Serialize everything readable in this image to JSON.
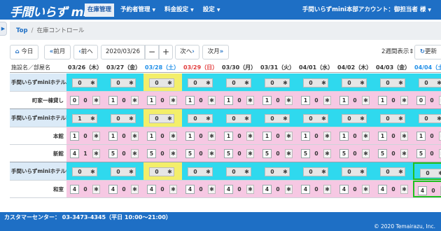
{
  "app": {
    "logo": "手間いらず mini"
  },
  "nav": {
    "items": [
      {
        "label": "在庫管理",
        "active": true,
        "dropdown": false
      },
      {
        "label": "予約者管理",
        "active": false,
        "dropdown": true
      },
      {
        "label": "料金設定",
        "active": false,
        "dropdown": true
      },
      {
        "label": "設定",
        "active": false,
        "dropdown": true
      }
    ],
    "account": "手間いらずmini本部アカウント：御担当者 様"
  },
  "breadcrumb": {
    "top": "Top",
    "separator": "/",
    "current": "在庫コントロール"
  },
  "toolbar": {
    "today": "今日",
    "prev_month": "前月",
    "prev": "前へ",
    "date": "2020/03/26",
    "minus": "−",
    "plus": "+",
    "next": "次へ",
    "next_month": "次月",
    "period": "2週間表示",
    "refresh": "更新"
  },
  "grid": {
    "name_header": "施設名／部屋名",
    "dates": [
      {
        "label": "03/26（木）",
        "day": "weekday"
      },
      {
        "label": "03/27（金）",
        "day": "weekday"
      },
      {
        "label": "03/28（土）",
        "day": "sat"
      },
      {
        "label": "03/29（日）",
        "day": "sun"
      },
      {
        "label": "03/30（月）",
        "day": "weekday"
      },
      {
        "label": "03/31（火）",
        "day": "weekday"
      },
      {
        "label": "04/01（水）",
        "day": "weekday"
      },
      {
        "label": "04/02（木）",
        "day": "weekday"
      },
      {
        "label": "04/03（金）",
        "day": "weekday"
      },
      {
        "label": "04/04（土）",
        "day": "sat"
      }
    ],
    "rows": [
      {
        "type": "hotel",
        "label": "手間いらずminiホテルA",
        "cells": [
          [
            0
          ],
          [
            0
          ],
          [
            0
          ],
          [
            0
          ],
          [
            0
          ],
          [
            0
          ],
          [
            0
          ],
          [
            0
          ],
          [
            0
          ],
          [
            0
          ]
        ]
      },
      {
        "type": "room",
        "label": "町家一棟貸し",
        "cells": [
          [
            0,
            0
          ],
          [
            1,
            0
          ],
          [
            1,
            0
          ],
          [
            1,
            0
          ],
          [
            1,
            0
          ],
          [
            1,
            0
          ],
          [
            1,
            0
          ],
          [
            1,
            0
          ],
          [
            1,
            0
          ],
          [
            0,
            0
          ]
        ]
      },
      {
        "type": "hotel",
        "label": "手間いらずminiホテルB",
        "cells": [
          [
            1
          ],
          [
            0
          ],
          [
            0
          ],
          [
            0
          ],
          [
            0
          ],
          [
            0
          ],
          [
            0
          ],
          [
            0
          ],
          [
            0
          ],
          [
            0
          ]
        ]
      },
      {
        "type": "room",
        "label": "本館",
        "cells": [
          [
            1,
            0
          ],
          [
            1,
            0
          ],
          [
            1,
            0
          ],
          [
            1,
            0
          ],
          [
            1,
            0
          ],
          [
            1,
            0
          ],
          [
            1,
            0
          ],
          [
            1,
            0
          ],
          [
            1,
            0
          ],
          [
            1,
            0
          ]
        ]
      },
      {
        "type": "room",
        "label": "新館",
        "cells": [
          [
            4,
            1
          ],
          [
            5,
            0
          ],
          [
            5,
            0
          ],
          [
            5,
            0
          ],
          [
            5,
            0
          ],
          [
            5,
            0
          ],
          [
            5,
            0
          ],
          [
            5,
            0
          ],
          [
            5,
            0
          ],
          [
            5,
            0
          ]
        ]
      },
      {
        "type": "hotel",
        "label": "手間いらずminiホテルC",
        "cells": [
          [
            0
          ],
          [
            0
          ],
          [
            0
          ],
          [
            0
          ],
          [
            0
          ],
          [
            0
          ],
          [
            0
          ],
          [
            0
          ],
          [
            0
          ],
          [
            0
          ]
        ]
      },
      {
        "type": "room",
        "label": "和室",
        "cells": [
          [
            4,
            0
          ],
          [
            4,
            0
          ],
          [
            4,
            0
          ],
          [
            4,
            0
          ],
          [
            4,
            0
          ],
          [
            4,
            0
          ],
          [
            4,
            0
          ],
          [
            4,
            0
          ],
          [
            4,
            0
          ],
          [
            4,
            0
          ]
        ]
      }
    ]
  },
  "colors": {
    "brand": "#1e6fc5",
    "cyan": "#2fd9ee",
    "pink": "#f6c8e3",
    "yellow": "#f3ee6a",
    "green": "#22c020"
  },
  "footer": {
    "contact": "カスタマーセンター： 03-3473-4345（平日 10:00〜21:00）",
    "copyright": "© 2020 Temairazu, Inc."
  }
}
